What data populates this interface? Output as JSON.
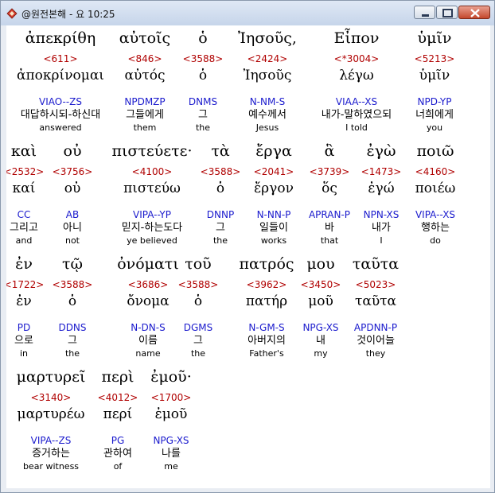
{
  "window": {
    "title": "@원전본해 - 요 10:25"
  },
  "icons": {
    "app": "bible-app-icon",
    "minimize": "minimize-icon",
    "maximize": "maximize-icon",
    "close": "close-icon"
  },
  "rows": [
    [
      {
        "greek": "ἀπεκρίθη",
        "strong": "<611>",
        "lemma": "ἀποκρίνομαι",
        "parsing": "VIAO--ZS",
        "korean": "대답하시되-하신대",
        "english": "answered"
      },
      {
        "greek": "αὐτοῖς",
        "strong": "<846>",
        "lemma": "αὐτός",
        "parsing": "NPDMZP",
        "korean": "그들에게",
        "english": "them"
      },
      {
        "greek": "ὁ",
        "strong": "<3588>",
        "lemma": "ὁ",
        "parsing": "DNMS",
        "korean": "그",
        "english": "the"
      },
      {
        "greek": "Ἰησοῦς,",
        "strong": "<2424>",
        "lemma": "Ἰησοῦς",
        "parsing": "N-NM-S",
        "korean": "예수께서",
        "english": "Jesus"
      },
      {
        "greek": "Εἶπον",
        "strong": "<*3004>",
        "lemma": "λέγω",
        "parsing": "VIAA--XS",
        "korean": "내가-말하였으되",
        "english": "I told"
      },
      {
        "greek": "ὑμῖν",
        "strong": "<5213>",
        "lemma": "ὑμῖν",
        "parsing": "NPD-YP",
        "korean": "너희에게",
        "english": "you"
      }
    ],
    [
      {
        "greek": "καὶ",
        "strong": "<2532>",
        "lemma": "καί",
        "parsing": "CC",
        "korean": "그리고",
        "english": "and"
      },
      {
        "greek": "οὐ",
        "strong": "<3756>",
        "lemma": "οὐ",
        "parsing": "AB",
        "korean": "아니",
        "english": "not"
      },
      {
        "greek": "πιστεύετε·",
        "strong": "<4100>",
        "lemma": "πιστεύω",
        "parsing": "VIPA--YP",
        "korean": "믿지-하는도다",
        "english": "ye believed"
      },
      {
        "greek": "τὰ",
        "strong": "<3588>",
        "lemma": "ὁ",
        "parsing": "DNNP",
        "korean": "그",
        "english": "the"
      },
      {
        "greek": "ἔργα",
        "strong": "<2041>",
        "lemma": "ἔργον",
        "parsing": "N-NN-P",
        "korean": "일들이",
        "english": "works"
      },
      {
        "greek": "ἃ",
        "strong": "<3739>",
        "lemma": "ὅς",
        "parsing": "APRAN-P",
        "korean": "바",
        "english": "that"
      },
      {
        "greek": "ἐγὼ",
        "strong": "<1473>",
        "lemma": "ἐγώ",
        "parsing": "NPN-XS",
        "korean": "내가",
        "english": "I"
      },
      {
        "greek": "ποιῶ",
        "strong": "<4160>",
        "lemma": "ποιέω",
        "parsing": "VIPA--XS",
        "korean": "행하는",
        "english": "do"
      }
    ],
    [
      {
        "greek": "ἐν",
        "strong": "<1722>",
        "lemma": "ἐν",
        "parsing": "PD",
        "korean": "으로",
        "english": "in"
      },
      {
        "greek": "τῷ",
        "strong": "<3588>",
        "lemma": "ὁ",
        "parsing": "DDNS",
        "korean": "그",
        "english": "the"
      },
      {
        "greek": "ὀνόματι",
        "strong": "<3686>",
        "lemma": "ὄνομα",
        "parsing": "N-DN-S",
        "korean": "이름",
        "english": "name"
      },
      {
        "greek": "τοῦ",
        "strong": "<3588>",
        "lemma": "ὁ",
        "parsing": "DGMS",
        "korean": "그",
        "english": "the"
      },
      {
        "greek": "πατρός",
        "strong": "<3962>",
        "lemma": "πατήρ",
        "parsing": "N-GM-S",
        "korean": "아버지의",
        "english": "Father's"
      },
      {
        "greek": "μου",
        "strong": "<3450>",
        "lemma": "μοῦ",
        "parsing": "NPG-XS",
        "korean": "내",
        "english": "my"
      },
      {
        "greek": "ταῦτα",
        "strong": "<5023>",
        "lemma": "ταῦτα",
        "parsing": "APDNN-P",
        "korean": "것이어늘",
        "english": "they"
      }
    ],
    [
      {
        "greek": "μαρτυρεῖ",
        "strong": "<3140>",
        "lemma": "μαρτυρέω",
        "parsing": "VIPA--ZS",
        "korean": "증거하는",
        "english": "bear witness"
      },
      {
        "greek": "περὶ",
        "strong": "<4012>",
        "lemma": "περί",
        "parsing": "PG",
        "korean": "관하여",
        "english": "of"
      },
      {
        "greek": "ἐμοῦ·",
        "strong": "<1700>",
        "lemma": "ἐμοῦ",
        "parsing": "NPG-XS",
        "korean": "나를",
        "english": "me"
      }
    ]
  ]
}
